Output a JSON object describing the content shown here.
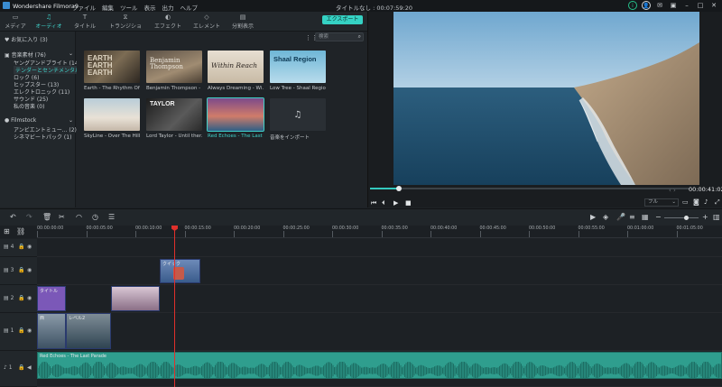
{
  "titlebar": {
    "app_name": "Wondershare Filmora9",
    "menus": [
      "ファイル",
      "編集",
      "ツール",
      "表示",
      "出力",
      "ヘルプ"
    ],
    "document": "タイトルなし : 00:07:59:20"
  },
  "tabs": [
    {
      "label": "メディア",
      "icon": "folder-icon"
    },
    {
      "label": "オーディオ",
      "icon": "music-note-icon"
    },
    {
      "label": "タイトル",
      "icon": "text-icon"
    },
    {
      "label": "トランジション",
      "icon": "transition-icon"
    },
    {
      "label": "エフェクト",
      "icon": "effects-icon"
    },
    {
      "label": "エレメント",
      "icon": "elements-icon"
    },
    {
      "label": "分割表示",
      "icon": "split-screen-icon"
    }
  ],
  "export_label": "エクスポート",
  "sidebar": {
    "favorites": "お気に入り (3)",
    "library_header": "音楽素材 (76)",
    "library_items": [
      "ヤングアンドブライト (14)",
      "テンダーとセンチメンタル (7)",
      "ロック (6)",
      "ヒップスター (13)",
      "エレクトロニック (11)",
      "サウンド (25)",
      "私の音楽 (0)"
    ],
    "filmstock_header": "Filmstock",
    "filmstock_items": [
      "アンビエントミュー... (2)",
      "シネマビートパック (1)"
    ]
  },
  "search": {
    "placeholder": "検索"
  },
  "library_items": [
    {
      "caption": "Earth - The Rhythm Of...",
      "thumb_text": "EARTH EARTH EARTH"
    },
    {
      "caption": "Benjamin Thompson - ...",
      "thumb_text": "Benjamin Thompson"
    },
    {
      "caption": "Always Dreaming - Wi...",
      "thumb_text": "Within Reach"
    },
    {
      "caption": "Low Tree - Shaal Region",
      "thumb_text": "Shaal Region"
    },
    {
      "caption": "SkyLine - Over The Hills",
      "thumb_text": ""
    },
    {
      "caption": "Lord Taylor - Until ther...",
      "thumb_text": "TAYLOR"
    },
    {
      "caption": "Red Echoes - The Last ...",
      "thumb_text": ""
    },
    {
      "caption": "音楽をインポート",
      "thumb_text": ""
    }
  ],
  "preview": {
    "timecode": "00:00:41:02",
    "quality": "フル",
    "progress": 0.09
  },
  "ruler_ticks": [
    "00:00:00:00",
    "00:00:05:00",
    "00:00:10:00",
    "00:00:15:00",
    "00:00:20:00",
    "00:00:25:00",
    "00:00:30:00",
    "00:00:35:00",
    "00:00:40:00",
    "00:00:45:00",
    "00:00:50:00",
    "00:00:55:00",
    "00:01:00:00",
    "00:01:05:00",
    "00:01:10:00"
  ],
  "tracks": {
    "labels": [
      "4",
      "3",
      "2",
      "1",
      "1"
    ],
    "clips": {
      "v3_title": "クイック",
      "v2_title": "タイトル",
      "v1_a": "西",
      "v1_b": "レベル2",
      "audio": "Red Echoes - The Last Parade"
    }
  },
  "colors": {
    "accent": "#35d2c4",
    "playhead": "#e0302b",
    "audio_clip": "#2f9e8e"
  }
}
